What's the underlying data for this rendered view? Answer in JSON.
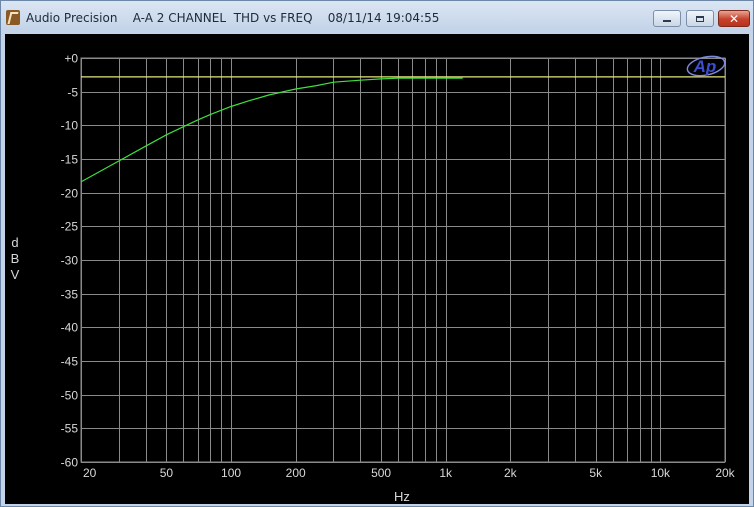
{
  "window": {
    "title": "Audio Precision    A-A 2 CHANNEL  THD vs FREQ    08/11/14 19:04:55",
    "controls": [
      "minimize",
      "maximize",
      "close"
    ],
    "close_glyph": "✕"
  },
  "logo": {
    "text": "Ap"
  },
  "colors": {
    "background": "#000000",
    "grid": "#8a8a8a",
    "trace": "#3ee03e",
    "reference": "#e6e67a",
    "text": "#d8d8d8",
    "logo": "#3d4ed0"
  },
  "chart_data": {
    "type": "line",
    "title": "A-A 2 CHANNEL  THD vs FREQ",
    "xlabel": "Hz",
    "ylabel": "dBV",
    "ylabel_letters": [
      "d",
      "B",
      "V"
    ],
    "xscale": "log",
    "xlim": [
      20,
      20000
    ],
    "ylim": [
      -60,
      0
    ],
    "grid": true,
    "y_ticks": [
      0,
      -5,
      -10,
      -15,
      -20,
      -25,
      -30,
      -35,
      -40,
      -45,
      -50,
      -55,
      -60
    ],
    "y_tick_labels": [
      "+0",
      "-5",
      "-10",
      "-15",
      "-20",
      "-25",
      "-30",
      "-35",
      "-40",
      "-45",
      "-50",
      "-55",
      "-60"
    ],
    "x_ticks": [
      20,
      50,
      100,
      200,
      500,
      1000,
      2000,
      5000,
      10000,
      20000
    ],
    "x_tick_labels": [
      "20",
      "50",
      "100",
      "200",
      "500",
      "1k",
      "2k",
      "5k",
      "10k",
      "20k"
    ],
    "series": [
      {
        "color": "#3ee03e",
        "x": [
          20,
          25,
          30,
          40,
          50,
          60,
          70,
          80,
          100,
          120,
          150,
          200,
          250,
          300,
          400,
          500,
          600,
          700,
          800,
          1000,
          1200
        ],
        "y": [
          -18.4,
          -16.7,
          -15.3,
          -13.1,
          -11.4,
          -10.2,
          -9.2,
          -8.4,
          -7.2,
          -6.4,
          -5.5,
          -4.6,
          -4.1,
          -3.6,
          -3.3,
          -3.1,
          -3.0,
          -3.0,
          -3.0,
          -3.0,
          -3.0
        ]
      },
      {
        "color": "#e6e67a",
        "x": [
          20,
          20000
        ],
        "y": [
          -2.8,
          -2.8
        ]
      }
    ]
  }
}
